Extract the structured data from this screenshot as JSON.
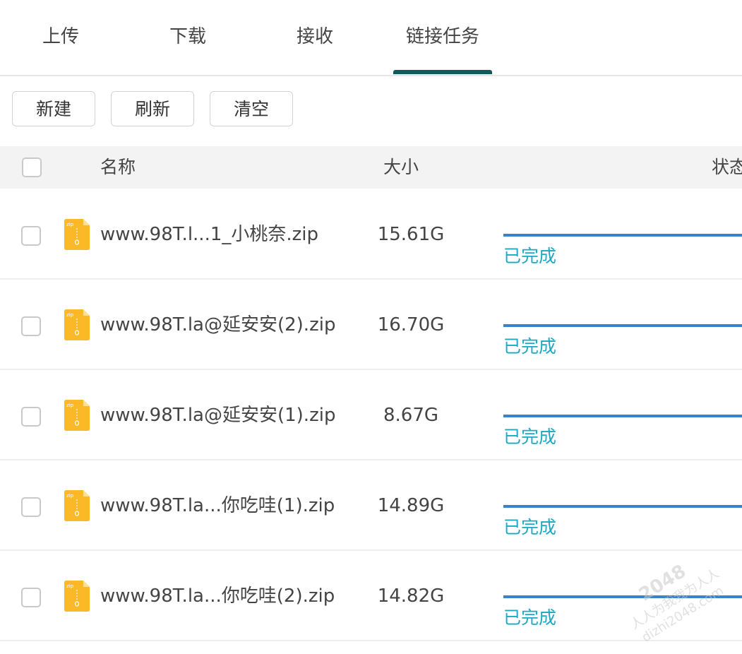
{
  "tabs": [
    {
      "label": "上传"
    },
    {
      "label": "下载"
    },
    {
      "label": "接收"
    },
    {
      "label": "链接任务",
      "active": true
    }
  ],
  "toolbar": {
    "new_label": "新建",
    "refresh_label": "刷新",
    "clear_label": "清空"
  },
  "table": {
    "headers": {
      "name": "名称",
      "size": "大小",
      "status": "状态"
    },
    "rows": [
      {
        "name": "www.98T.l...1_小桃奈.zip",
        "size": "15.61G",
        "progress": 1.0,
        "status": "已完成",
        "icon": "zip-file-icon"
      },
      {
        "name": "www.98T.la@延安安(2).zip",
        "size": "16.70G",
        "progress": 1.0,
        "status": "已完成",
        "icon": "zip-file-icon"
      },
      {
        "name": "www.98T.la@延安安(1).zip",
        "size": "8.67G",
        "progress": 1.0,
        "status": "已完成",
        "icon": "zip-file-icon"
      },
      {
        "name": "www.98T.la...你吃哇(1).zip",
        "size": "14.89G",
        "progress": 1.0,
        "status": "已完成",
        "icon": "zip-file-icon"
      },
      {
        "name": "www.98T.la...你吃哇(2).zip",
        "size": "14.82G",
        "progress": 1.0,
        "status": "已完成",
        "icon": "zip-file-icon"
      }
    ]
  },
  "watermark": {
    "line1": "2048",
    "line2": "人人为我我为人人",
    "line3": "dizhi2048.com"
  },
  "colors": {
    "tab_active_underline": "#0d5a5c",
    "progress": "#3b82c8",
    "status_done": "#1fa8c4",
    "zip_icon": "#fbb829"
  }
}
